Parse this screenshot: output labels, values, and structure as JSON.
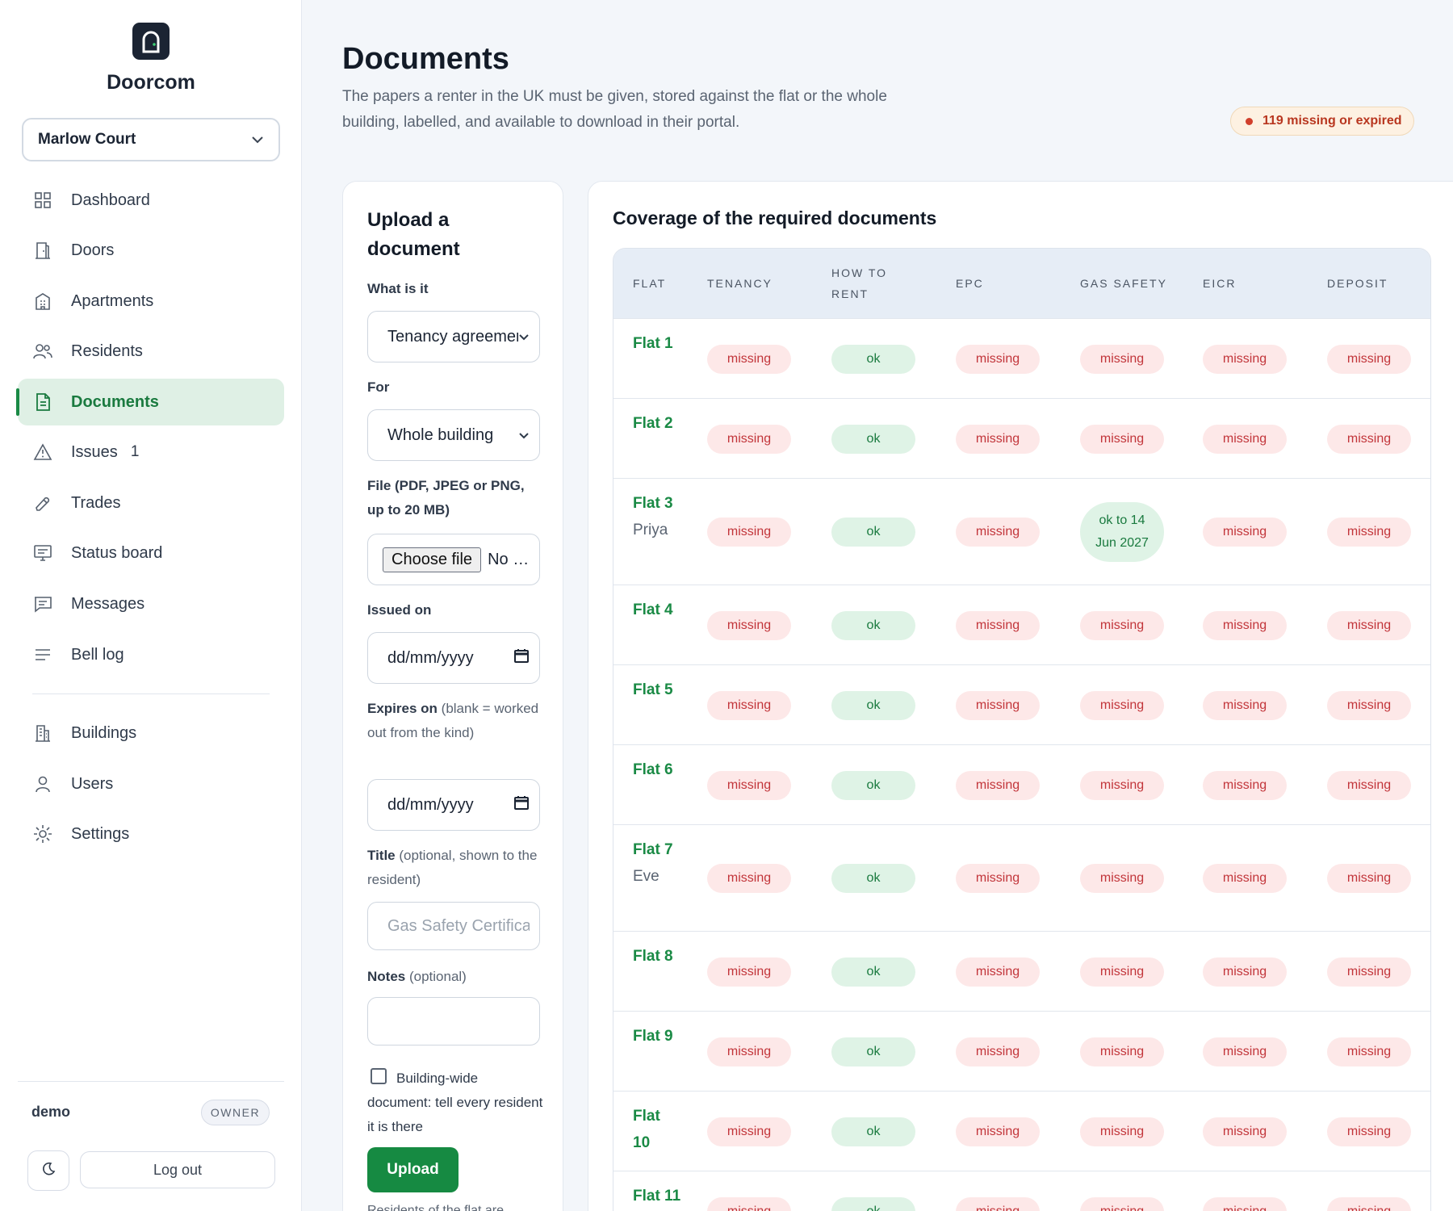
{
  "brand": {
    "name": "Doorcom"
  },
  "building_select": {
    "value": "Marlow Court"
  },
  "nav": [
    {
      "label": "Dashboard",
      "icon": "grid-icon"
    },
    {
      "label": "Doors",
      "icon": "door-icon"
    },
    {
      "label": "Apartments",
      "icon": "apartment-icon"
    },
    {
      "label": "Residents",
      "icon": "users-icon"
    },
    {
      "label": "Documents",
      "icon": "document-icon",
      "active": true
    },
    {
      "label": "Issues",
      "icon": "warning-icon",
      "badge": "1"
    },
    {
      "label": "Trades",
      "icon": "wrench-icon"
    },
    {
      "label": "Status board",
      "icon": "monitor-icon"
    },
    {
      "label": "Messages",
      "icon": "message-icon"
    },
    {
      "label": "Bell log",
      "icon": "list-icon"
    }
  ],
  "nav_admin": [
    {
      "label": "Buildings",
      "icon": "building-icon"
    },
    {
      "label": "Users",
      "icon": "user-icon"
    },
    {
      "label": "Settings",
      "icon": "gear-icon"
    }
  ],
  "user": {
    "name": "demo",
    "role": "OWNER",
    "logout": "Log out"
  },
  "header": {
    "title": "Documents",
    "subtitle": "The papers a renter in the UK must be given, stored against the flat or the whole building, labelled, and available to download in their portal.",
    "alert": "119 missing or expired"
  },
  "upload": {
    "title": "Upload a document",
    "what_label": "What is it",
    "what_value": "Tenancy agreement",
    "for_label": "For",
    "for_value": "Whole building",
    "file_label": "File (PDF, JPEG or PNG, up to 20 MB)",
    "file_button": "Choose file",
    "file_status": "No file chosen",
    "issued_label": "Issued on",
    "date_placeholder": "dd/mm/yyyy",
    "expires_label": "Expires on",
    "expires_hint": "(blank = worked out from the kind)",
    "title_label": "Title",
    "title_hint": "(optional, shown to the resident)",
    "title_placeholder": "Gas Safety Certificate",
    "notes_label": "Notes",
    "notes_hint": "(optional)",
    "building_wide_label": "Building-wide document: tell every resident it is there",
    "upload_button": "Upload",
    "footnote": "Residents of the flat are"
  },
  "coverage": {
    "title": "Coverage of the required documents",
    "columns": [
      "FLAT",
      "TENANCY",
      "HOW TO RENT",
      "EPC",
      "GAS SAFETY",
      "EICR",
      "DEPOSIT"
    ],
    "rows": [
      {
        "flat": "Flat 1",
        "resident": "",
        "cells": [
          "missing",
          "ok",
          "missing",
          "missing",
          "missing",
          "missing"
        ]
      },
      {
        "flat": "Flat 2",
        "resident": "",
        "cells": [
          "missing",
          "ok",
          "missing",
          "missing",
          "missing",
          "missing"
        ]
      },
      {
        "flat": "Flat 3",
        "resident": "Priya",
        "cells": [
          "missing",
          "ok",
          "missing",
          "ok to 14 Jun 2027",
          "missing",
          "missing"
        ]
      },
      {
        "flat": "Flat 4",
        "resident": "",
        "cells": [
          "missing",
          "ok",
          "missing",
          "missing",
          "missing",
          "missing"
        ]
      },
      {
        "flat": "Flat 5",
        "resident": "",
        "cells": [
          "missing",
          "ok",
          "missing",
          "missing",
          "missing",
          "missing"
        ]
      },
      {
        "flat": "Flat 6",
        "resident": "",
        "cells": [
          "missing",
          "ok",
          "missing",
          "missing",
          "missing",
          "missing"
        ]
      },
      {
        "flat": "Flat 7",
        "resident": "Eve",
        "cells": [
          "missing",
          "ok",
          "missing",
          "missing",
          "missing",
          "missing"
        ]
      },
      {
        "flat": "Flat 8",
        "resident": "",
        "cells": [
          "missing",
          "ok",
          "missing",
          "missing",
          "missing",
          "missing"
        ]
      },
      {
        "flat": "Flat 9",
        "resident": "",
        "cells": [
          "missing",
          "ok",
          "missing",
          "missing",
          "missing",
          "missing"
        ]
      },
      {
        "flat": "Flat 10",
        "resident": "",
        "cells": [
          "missing",
          "ok",
          "missing",
          "missing",
          "missing",
          "missing"
        ]
      },
      {
        "flat": "Flat 11",
        "resident": "",
        "cells": [
          "missing",
          "ok",
          "missing",
          "missing",
          "missing",
          "missing"
        ]
      }
    ]
  },
  "colors": {
    "accent": "#168a42",
    "missing_bg": "#fde8e8",
    "missing_text": "#c2353a",
    "ok_bg": "#dff3e6",
    "ok_text": "#1a7a3f"
  }
}
